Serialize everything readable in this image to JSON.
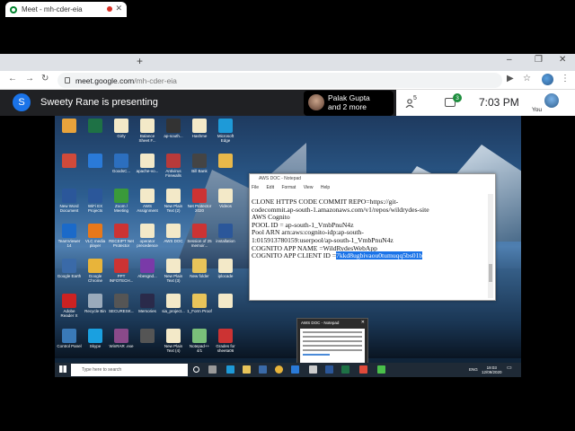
{
  "browser": {
    "tab_title": "Meet - mh-cder-eia",
    "new_tab": "+",
    "url_host": "meet.google.com",
    "url_path": "/mh-cder-eia",
    "window_controls": [
      "–",
      "❐",
      "✕"
    ]
  },
  "meet": {
    "presenter_initial": "S",
    "presenting_text": "Sweety Rane is presenting",
    "presenter_chip_line1": "Palak Gupta",
    "presenter_chip_line2": "and 2 more",
    "people_count": "5",
    "chat_badge": "3",
    "time": "7:03 PM",
    "you_label": "You"
  },
  "notepad": {
    "title": "AWS DOC - Notepad",
    "menu": [
      "File",
      "Edit",
      "Format",
      "View",
      "Help"
    ],
    "lines": [
      "CLONE HTTPS CODE COMMIT REPO=https://git-",
      "codecommit.ap-south-1.amazonaws.com/v1/repos/wildrydes-site",
      "",
      "",
      "AWS Cognito",
      "POOL ID = ap-south-1_VmbPnuN4z",
      "Pool ARN arn:aws:cognito-idp:ap-south-",
      "1:015913780159:userpool/ap-south-1_VmbPnuN4z",
      "",
      "COGNITO APP NAME =WildRydesWebApp"
    ],
    "last_line_prefix": "COGNITO APP CLIENT ID =",
    "last_line_selected": "7kkd8ugbivaou0tumuqq5bs01b"
  },
  "taskbar_preview": {
    "title": "AWS DOC - Notepad"
  },
  "taskbar": {
    "search_placeholder": "Type here to search",
    "lang": "ENG",
    "clock_time": "19:03",
    "clock_date": "12/09/2020"
  },
  "desktop_icons": [
    {
      "label": "",
      "color": "#e8a33c"
    },
    {
      "label": "",
      "color": "#1e7145"
    },
    {
      "label": "Girly",
      "color": "#f3e9c8"
    },
    {
      "label": "Balance Sheet F...",
      "color": "#f3e9c8"
    },
    {
      "label": "ap-south...",
      "color": "#333"
    },
    {
      "label": "Hashme",
      "color": "#f3e9c8"
    },
    {
      "label": "Microsoft Edge",
      "color": "#1e9ad8"
    },
    {
      "label": "",
      "color": "#d04a3a"
    },
    {
      "label": "",
      "color": "#2a7ad8"
    },
    {
      "label": "GoodsC...",
      "color": "#2c6fbf"
    },
    {
      "label": "apache-vo...",
      "color": "#f3e9c8"
    },
    {
      "label": "Antivirus Firewalls",
      "color": "#b83a3a"
    },
    {
      "label": "Bill Bank",
      "color": "#444"
    },
    {
      "label": "",
      "color": "#e8b84a"
    },
    {
      "label": "New Word Document",
      "color": "#2b579a"
    },
    {
      "label": "WiFi EX Projects",
      "color": "#2b579a"
    },
    {
      "label": "Zoom / Meeting",
      "color": "#3a9a3a"
    },
    {
      "label": "AWS Assignment",
      "color": "#f3e9c8"
    },
    {
      "label": "New Plain Text (2)",
      "color": "#f3e9c8"
    },
    {
      "label": "Net Protector 2020",
      "color": "#cc3333"
    },
    {
      "label": "Videos",
      "color": "#f3e9c8"
    },
    {
      "label": "TeamViewer 14",
      "color": "#1b6ac9"
    },
    {
      "label": "VLC media player",
      "color": "#e8781a"
    },
    {
      "label": "RECEIPT Net Protector",
      "color": "#cc3333"
    },
    {
      "label": "operator precedence",
      "color": "#f3e9c8"
    },
    {
      "label": "AWS DOC",
      "color": "#f3e9c8"
    },
    {
      "label": "Session of 25 memoir...",
      "color": "#cc3333"
    },
    {
      "label": "installation",
      "color": "#2b579a"
    },
    {
      "label": "Google Earth",
      "color": "#3a6aa8"
    },
    {
      "label": "Google Chrome",
      "color": "#e8b43a"
    },
    {
      "label": "PPT INFOTECH...",
      "color": "#cc3333"
    },
    {
      "label": "Abesgnd...",
      "color": "#7a3aa8"
    },
    {
      "label": "New Plain Text (3)",
      "color": "#f3e9c8"
    },
    {
      "label": "New folder",
      "color": "#e8c45a"
    },
    {
      "label": "iplocade",
      "color": "#f3e9c8"
    },
    {
      "label": "Adobe Reader X",
      "color": "#cc2222"
    },
    {
      "label": "Recycle Bin",
      "color": "#9aaabb"
    },
    {
      "label": "SECURESK...",
      "color": "#555"
    },
    {
      "label": "Memories",
      "color": "#2a2a4a"
    },
    {
      "label": "sia_project...",
      "color": "#f3e9c8"
    },
    {
      "label": "1_Form Proof",
      "color": "#e8c45a"
    },
    {
      "label": "",
      "color": "#f3e9c8"
    },
    {
      "label": "Control Panel",
      "color": "#3a7ab8"
    },
    {
      "label": "Skype",
      "color": "#1aa0e0"
    },
    {
      "label": "WinRAR .exe",
      "color": "#8a4a8a"
    },
    {
      "label": "",
      "color": "#555"
    },
    {
      "label": "New Plain Text (4)",
      "color": "#f3e9c8"
    },
    {
      "label": "Notepad++ 4/1",
      "color": "#7ac07a"
    },
    {
      "label": "Grades for sheeta06",
      "color": "#cc3333"
    }
  ]
}
